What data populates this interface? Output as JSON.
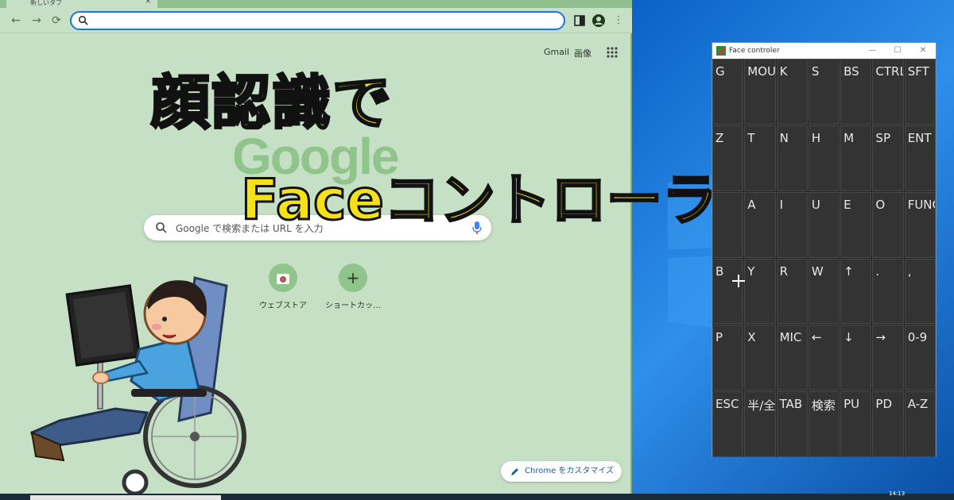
{
  "browser": {
    "tab_title": "新しいタブ",
    "tab_close": "×",
    "omnibox_value": "",
    "links": {
      "gmail": "Gmail",
      "images": "画像"
    },
    "search_placeholder": "Google で検索または URL を入力",
    "shortcuts": [
      {
        "label": "ウェブストア",
        "icon": "chrome-store-icon"
      },
      {
        "label": "ショートカッ…",
        "icon": "plus-icon",
        "glyph": "+"
      }
    ],
    "customize_label": "Chrome をカスタマイズ"
  },
  "overlay": {
    "title_line1": "顔認識で",
    "title_line2": "Faceコントローラー"
  },
  "face_controller": {
    "window_title": "Face controler",
    "keys": [
      [
        "G",
        "MOU",
        "K",
        "S",
        "BS",
        "CTRL",
        "SFT"
      ],
      [
        "Z",
        "T",
        "N",
        "H",
        "M",
        "SP",
        "ENT"
      ],
      [
        "",
        "A",
        "I",
        "U",
        "E",
        "O",
        "FUNC"
      ],
      [
        "B",
        "Y",
        "R",
        "W",
        "↑",
        ".",
        ","
      ],
      [
        "P",
        "X",
        "MIC",
        "←",
        "↓",
        "→",
        "0-9"
      ],
      [
        "ESC",
        "半/全",
        "TAB",
        "検索",
        "PU",
        "PD",
        "A-Z"
      ]
    ]
  },
  "taskbar": {
    "clock": "14:13"
  },
  "colors": {
    "accent": "#1a73e8",
    "title_yellow": "#f5e11a",
    "chrome_bg": "#c6e0c5"
  }
}
